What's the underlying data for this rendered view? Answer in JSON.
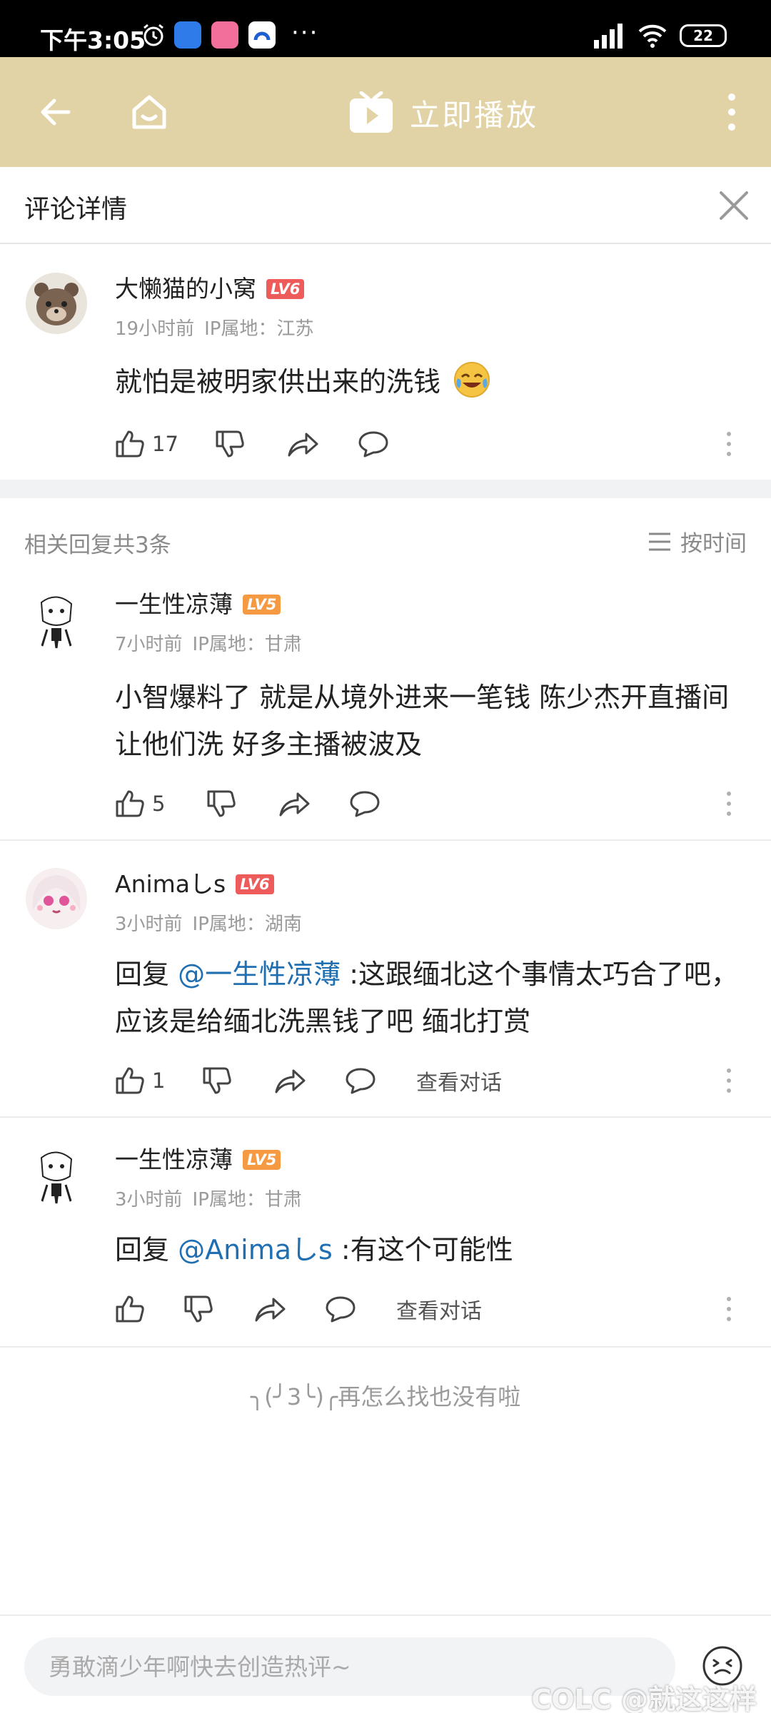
{
  "status_bar": {
    "time": "下午3:05",
    "overflow": "···",
    "battery": "22",
    "icons": [
      "alarm-icon",
      "browser-icon",
      "bilibili-icon",
      "app-icon",
      "signal-icon",
      "wifi-icon",
      "battery-icon"
    ]
  },
  "app_bar": {
    "play_label": "立即播放",
    "icons": [
      "back-arrow-icon",
      "home-icon",
      "tv-play-icon",
      "more-vertical-icon"
    ]
  },
  "detail": {
    "title": "评论详情",
    "close_icon": "close-icon"
  },
  "main_comment": {
    "username": "大懒猫的小窝",
    "level": "LV6",
    "time": "19小时前",
    "ip": "IP属地：江苏",
    "text": "就怕是被明家供出来的洗钱",
    "emoji": "crying-laughing-emoji",
    "like_count": "17"
  },
  "replies_header": {
    "count_label": "相关回复共3条",
    "sort_label": "按时间"
  },
  "replies": [
    {
      "username": "一生性凉薄",
      "level": "LV5",
      "time": "7小时前",
      "ip": "IP属地：甘肃",
      "text": "小智爆料了  就是从境外进来一笔钱  陈少杰开直播间让他们洗  好多主播被波及",
      "like_count": "5"
    },
    {
      "username": "Animaしs",
      "level": "LV6",
      "time": "3小时前",
      "ip": "IP属地：湖南",
      "reply_prefix": "回复 ",
      "mention": "@一生性凉薄",
      "text": " :这跟缅北这个事情太巧合了吧，应该是给缅北洗黑钱了吧 缅北打赏",
      "like_count": "1",
      "view_dialog": "查看对话"
    },
    {
      "username": "一生性凉薄",
      "level": "LV5",
      "time": "3小时前",
      "ip": "IP属地：甘肃",
      "reply_prefix": "回复 ",
      "mention": "@Animaしs",
      "text": " :有这个可能性",
      "view_dialog": "查看对话"
    }
  ],
  "end_text": "╮(╯3╰)╭再怎么找也没有啦",
  "bottom_bar": {
    "input_placeholder": "勇敢滴少年啊快去创造热评~",
    "watermark": "COLC @就这这样"
  },
  "colors": {
    "app_bar": "#e2d3a6",
    "mention": "#1f6fb2",
    "lv5_badge": "#f59a42",
    "lv6_badge": "#ee5b5b"
  }
}
